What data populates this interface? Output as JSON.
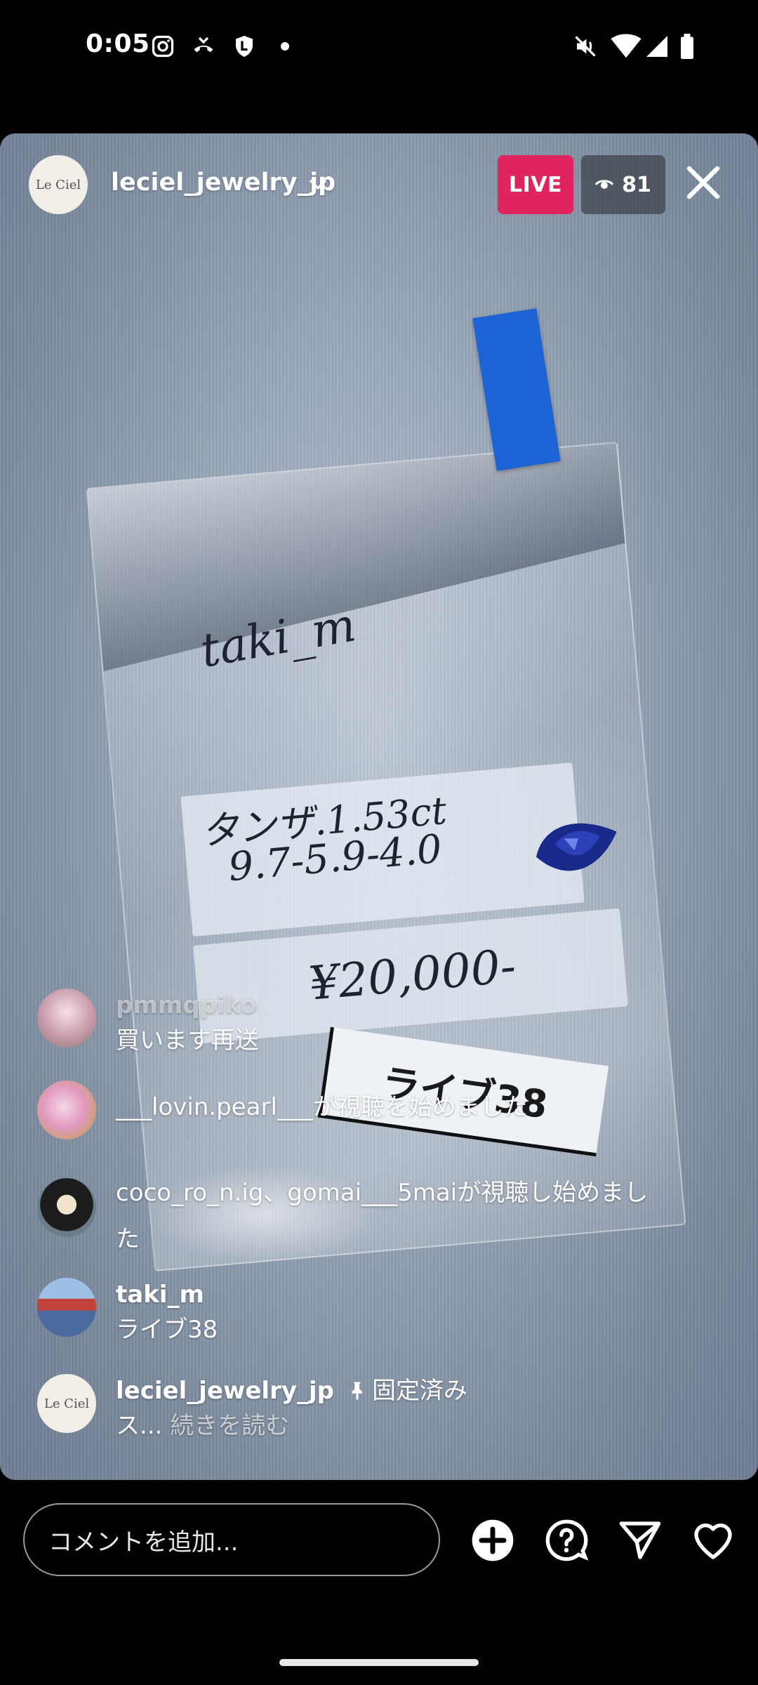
{
  "status_bar": {
    "time": "0:05",
    "left_icons": [
      "instagram-icon",
      "call-forward-icon",
      "shield-l-icon",
      "dot-icon"
    ],
    "right_icons": [
      "mute-icon",
      "wifi-icon",
      "signal-icon",
      "battery-icon"
    ]
  },
  "header": {
    "host_avatar_text": "Le Ciel",
    "host_username": "leciel_jewelry_jp",
    "live_label": "LIVE",
    "viewer_count": "81"
  },
  "video": {
    "handwritten_name": "taki_m",
    "desc_line1": "タンザ.1.53ct",
    "desc_line2": "9.7-5.9-4.0",
    "price": "¥20,000-",
    "tag_label": "ライブ38",
    "gem_color": "#1a2a8a",
    "tape_color": "#1e63d6"
  },
  "comments": [
    {
      "user": "pmmqpiko",
      "text": "買います再送"
    },
    {
      "user": "",
      "text": "___lovin.pearl___が視聴を始めました"
    },
    {
      "user": "",
      "text": "coco_ro_n.ig、gomai___5maiが視聴し始めました"
    },
    {
      "user": "taki_m",
      "text": "ライブ38"
    },
    {
      "user": "leciel_jewelry_jp",
      "pinned_label": "固定済み",
      "text": "ス...",
      "more_label": "続きを読む"
    }
  ],
  "bottom_bar": {
    "comment_placeholder": "コメントを追加...",
    "icons": [
      "add-icon",
      "question-icon",
      "send-icon",
      "heart-icon"
    ]
  },
  "colors": {
    "live_badge": "#e0245e",
    "background": "#000000"
  }
}
